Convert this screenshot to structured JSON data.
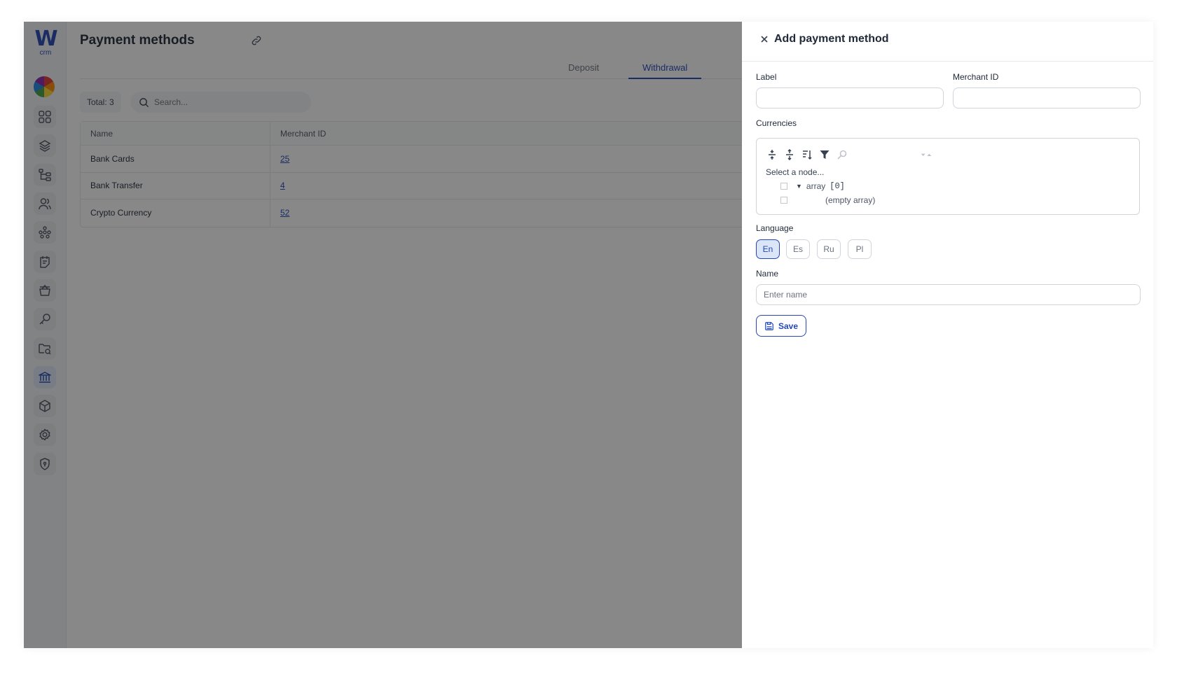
{
  "sidebar": {
    "logo_letter": "W",
    "logo_sub": "crm",
    "items": [
      {
        "icon": "grid-icon"
      },
      {
        "icon": "layers-icon"
      },
      {
        "icon": "hierarchy-icon"
      },
      {
        "icon": "users-icon"
      },
      {
        "icon": "network-icon"
      },
      {
        "icon": "notes-icon"
      },
      {
        "icon": "basket-icon"
      },
      {
        "icon": "key-icon"
      },
      {
        "icon": "folder-search-icon"
      },
      {
        "icon": "bank-icon",
        "active": true
      },
      {
        "icon": "box-icon"
      },
      {
        "icon": "settings-icon"
      },
      {
        "icon": "shield-icon"
      }
    ]
  },
  "page": {
    "title": "Payment methods",
    "tabs": [
      {
        "label": "Deposit",
        "active": false
      },
      {
        "label": "Withdrawal",
        "active": true
      }
    ],
    "total_label": "Total: 3",
    "search_placeholder": "Search..."
  },
  "table": {
    "headers": [
      "Name",
      "Merchant ID"
    ],
    "rows": [
      {
        "name": "Bank Cards",
        "merchant_id": "25"
      },
      {
        "name": "Bank Transfer",
        "merchant_id": "4"
      },
      {
        "name": "Crypto Currency",
        "merchant_id": "52"
      }
    ]
  },
  "drawer": {
    "title": "Add payment method",
    "label_field": {
      "label": "Label",
      "value": ""
    },
    "merchant_field": {
      "label": "Merchant ID",
      "value": ""
    },
    "currencies": {
      "label": "Currencies",
      "hint": "Select a node...",
      "node_name": "array",
      "node_count": "[0]",
      "empty_text": "(empty array)"
    },
    "language": {
      "label": "Language",
      "options": [
        "En",
        "Es",
        "Ru",
        "Pl"
      ],
      "selected": "En"
    },
    "name_field": {
      "label": "Name",
      "placeholder": "Enter name"
    },
    "save_label": "Save"
  },
  "colors": {
    "accent": "#2546b8",
    "overlay": "rgba(17,17,17,0.5)"
  }
}
